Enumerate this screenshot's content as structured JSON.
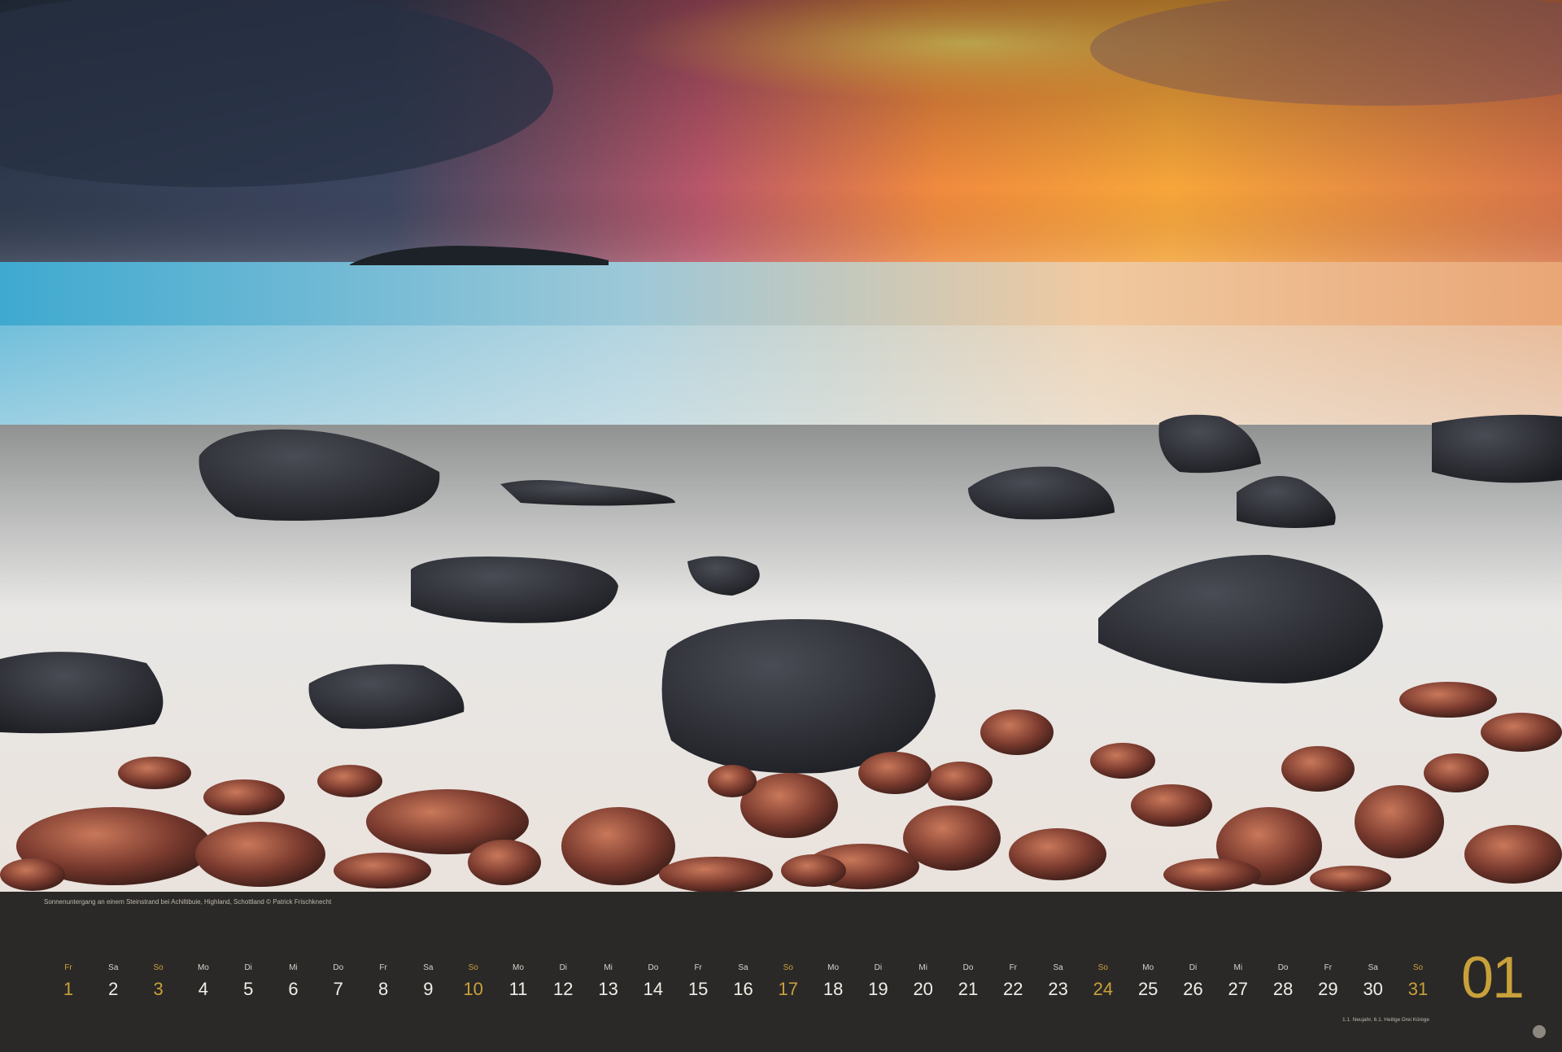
{
  "photo": {
    "caption": "Sonnenuntergang an einem Steinstrand bei Achiltibuie, Highland, Schottland © Patrick Frischknecht"
  },
  "calendar": {
    "month_number": "01",
    "holidays_note": "1.1. Neujahr, 6.1. Heilige Drei Könige",
    "days": [
      {
        "wd": "Fr",
        "num": "1"
      },
      {
        "wd": "Sa",
        "num": "2"
      },
      {
        "wd": "So",
        "num": "3"
      },
      {
        "wd": "Mo",
        "num": "4"
      },
      {
        "wd": "Di",
        "num": "5"
      },
      {
        "wd": "Mi",
        "num": "6"
      },
      {
        "wd": "Do",
        "num": "7"
      },
      {
        "wd": "Fr",
        "num": "8"
      },
      {
        "wd": "Sa",
        "num": "9"
      },
      {
        "wd": "So",
        "num": "10"
      },
      {
        "wd": "Mo",
        "num": "11"
      },
      {
        "wd": "Di",
        "num": "12"
      },
      {
        "wd": "Mi",
        "num": "13"
      },
      {
        "wd": "Do",
        "num": "14"
      },
      {
        "wd": "Fr",
        "num": "15"
      },
      {
        "wd": "Sa",
        "num": "16"
      },
      {
        "wd": "So",
        "num": "17"
      },
      {
        "wd": "Mo",
        "num": "18"
      },
      {
        "wd": "Di",
        "num": "19"
      },
      {
        "wd": "Mi",
        "num": "20"
      },
      {
        "wd": "Do",
        "num": "21"
      },
      {
        "wd": "Fr",
        "num": "22"
      },
      {
        "wd": "Sa",
        "num": "23"
      },
      {
        "wd": "So",
        "num": "24"
      },
      {
        "wd": "Mo",
        "num": "25"
      },
      {
        "wd": "Di",
        "num": "26"
      },
      {
        "wd": "Mi",
        "num": "27"
      },
      {
        "wd": "Do",
        "num": "28"
      },
      {
        "wd": "Fr",
        "num": "29"
      },
      {
        "wd": "Sa",
        "num": "30"
      },
      {
        "wd": "So",
        "num": "31"
      }
    ]
  },
  "colors": {
    "accent": "#c9a13a",
    "strip_bg": "#2b2927",
    "text": "#f1eee8"
  }
}
